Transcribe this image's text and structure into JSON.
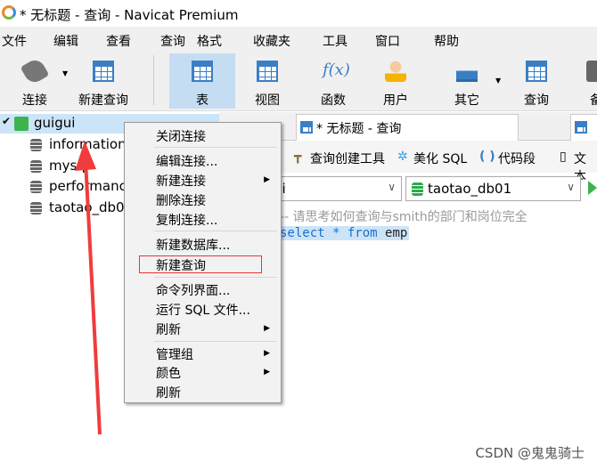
{
  "window": {
    "title": "* 无标题 - 查询 - Navicat Premium"
  },
  "menu": [
    "文件",
    "编辑",
    "查看",
    "查询",
    "格式",
    "收藏夹",
    "工具",
    "窗口",
    "帮助"
  ],
  "toolbar": [
    {
      "label": "连接",
      "icon": "plug-icon"
    },
    {
      "label": "新建查询",
      "icon": "new-query-icon"
    },
    {
      "label": "表",
      "icon": "table-icon",
      "active": true
    },
    {
      "label": "视图",
      "icon": "view-icon"
    },
    {
      "label": "函数",
      "icon": "function-icon"
    },
    {
      "label": "用户",
      "icon": "user-icon"
    },
    {
      "label": "其它",
      "icon": "tools-icon"
    },
    {
      "label": "查询",
      "icon": "query-icon"
    },
    {
      "label": "备",
      "icon": "backup-icon"
    }
  ],
  "tree": {
    "connection": "guigui",
    "databases": [
      "information",
      "mysql",
      "performanc",
      "taotao_db0"
    ]
  },
  "tabs": [
    {
      "label": "* 无标题 - 查询"
    }
  ],
  "query_toolbar": {
    "builder": "查询创建工具",
    "beautify": "美化 SQL",
    "snippet": "代码段",
    "text": "文本"
  },
  "combos": {
    "connection": "ui",
    "database": "taotao_db01"
  },
  "editor": {
    "line1": "-- 请思考如何查询与smith的部门和岗位完全",
    "line2": "select * from emp"
  },
  "context_menu": [
    {
      "label": "关闭连接"
    },
    {
      "sep": true
    },
    {
      "label": "编辑连接..."
    },
    {
      "label": "新建连接",
      "submenu": true
    },
    {
      "label": "删除连接"
    },
    {
      "label": "复制连接..."
    },
    {
      "sep": true
    },
    {
      "label": "新建数据库..."
    },
    {
      "label": "新建查询",
      "highlighted": true
    },
    {
      "sep": true
    },
    {
      "label": "命令列界面..."
    },
    {
      "label": "运行 SQL 文件..."
    },
    {
      "label": "刷新",
      "submenu": true
    },
    {
      "sep": true
    },
    {
      "label": "管理组",
      "submenu": true
    },
    {
      "label": "颜色",
      "submenu": true
    },
    {
      "label": "刷新"
    }
  ],
  "watermark": "CSDN @鬼鬼骑士",
  "colors": {
    "accent": "#3a7fc4",
    "highlight_box": "#e33333",
    "arrow": "#f03c3c",
    "selected": "#cce4f7"
  }
}
